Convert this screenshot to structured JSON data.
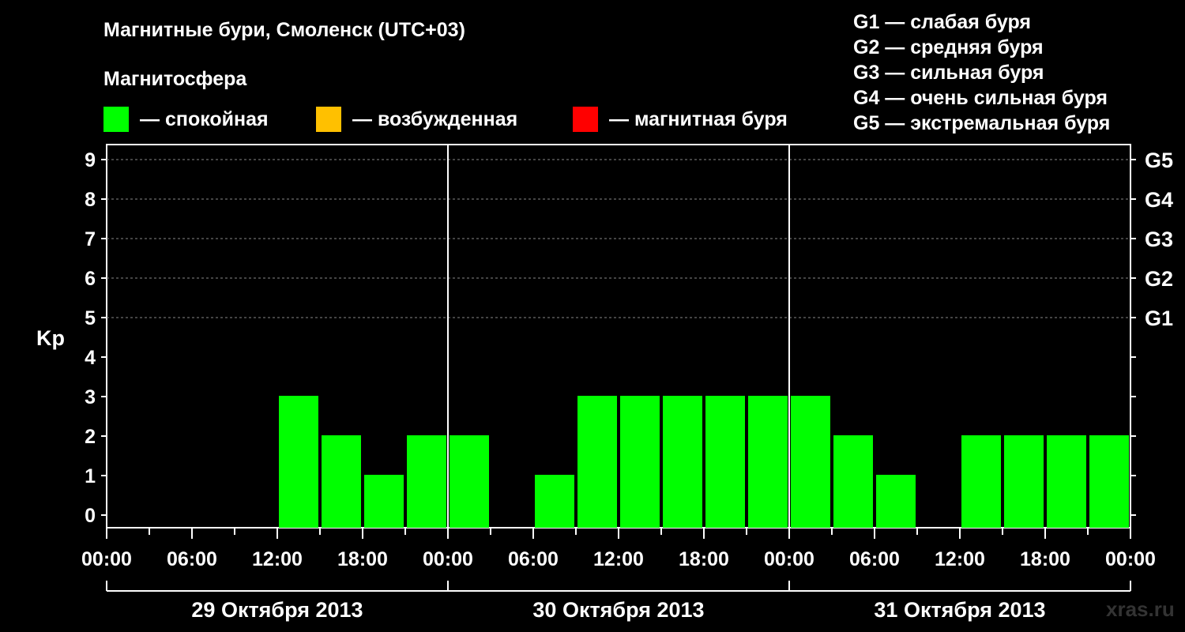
{
  "title": "Магнитные бури, Смоленск (UTC+03)",
  "subtitle": "Магнитосфера",
  "legend": [
    {
      "label": "— спокойная",
      "color": "#00ff00"
    },
    {
      "label": "— возбужденная",
      "color": "#ffc000"
    },
    {
      "label": "— магнитная буря",
      "color": "#ff0000"
    }
  ],
  "g_legend": [
    "G1 — слабая буря",
    "G2 — средняя буря",
    "G3 — сильная буря",
    "G4 — очень сильная буря",
    "G5 — экстремальная буря"
  ],
  "watermark": "xras.ru",
  "chart_data": {
    "type": "bar",
    "ylabel": "Kp",
    "ylim": [
      0,
      9
    ],
    "y_ticks": [
      "0",
      "1",
      "2",
      "3",
      "4",
      "5",
      "6",
      "7",
      "8",
      "9"
    ],
    "right_ticks": [
      {
        "kp": 5,
        "label": "G1"
      },
      {
        "kp": 6,
        "label": "G2"
      },
      {
        "kp": 7,
        "label": "G3"
      },
      {
        "kp": 8,
        "label": "G4"
      },
      {
        "kp": 9,
        "label": "G5"
      }
    ],
    "x_tick_labels": [
      "00:00",
      "06:00",
      "12:00",
      "18:00",
      "00:00",
      "06:00",
      "12:00",
      "18:00",
      "00:00",
      "06:00",
      "12:00",
      "18:00",
      "00:00"
    ],
    "days": [
      "29 Октября 2013",
      "30 Октября 2013",
      "31 Октября 2013"
    ],
    "bar_hours": 3,
    "values": [
      0,
      0,
      0,
      0,
      3,
      2,
      1,
      2,
      2,
      0,
      1,
      3,
      3,
      3,
      3,
      3,
      3,
      2,
      1,
      0,
      2,
      2,
      2,
      2
    ],
    "colors": {
      "quiet": "#00ff00",
      "active": "#ffc000",
      "storm": "#ff0000"
    },
    "grid": "dashed at Kp 5–9"
  }
}
